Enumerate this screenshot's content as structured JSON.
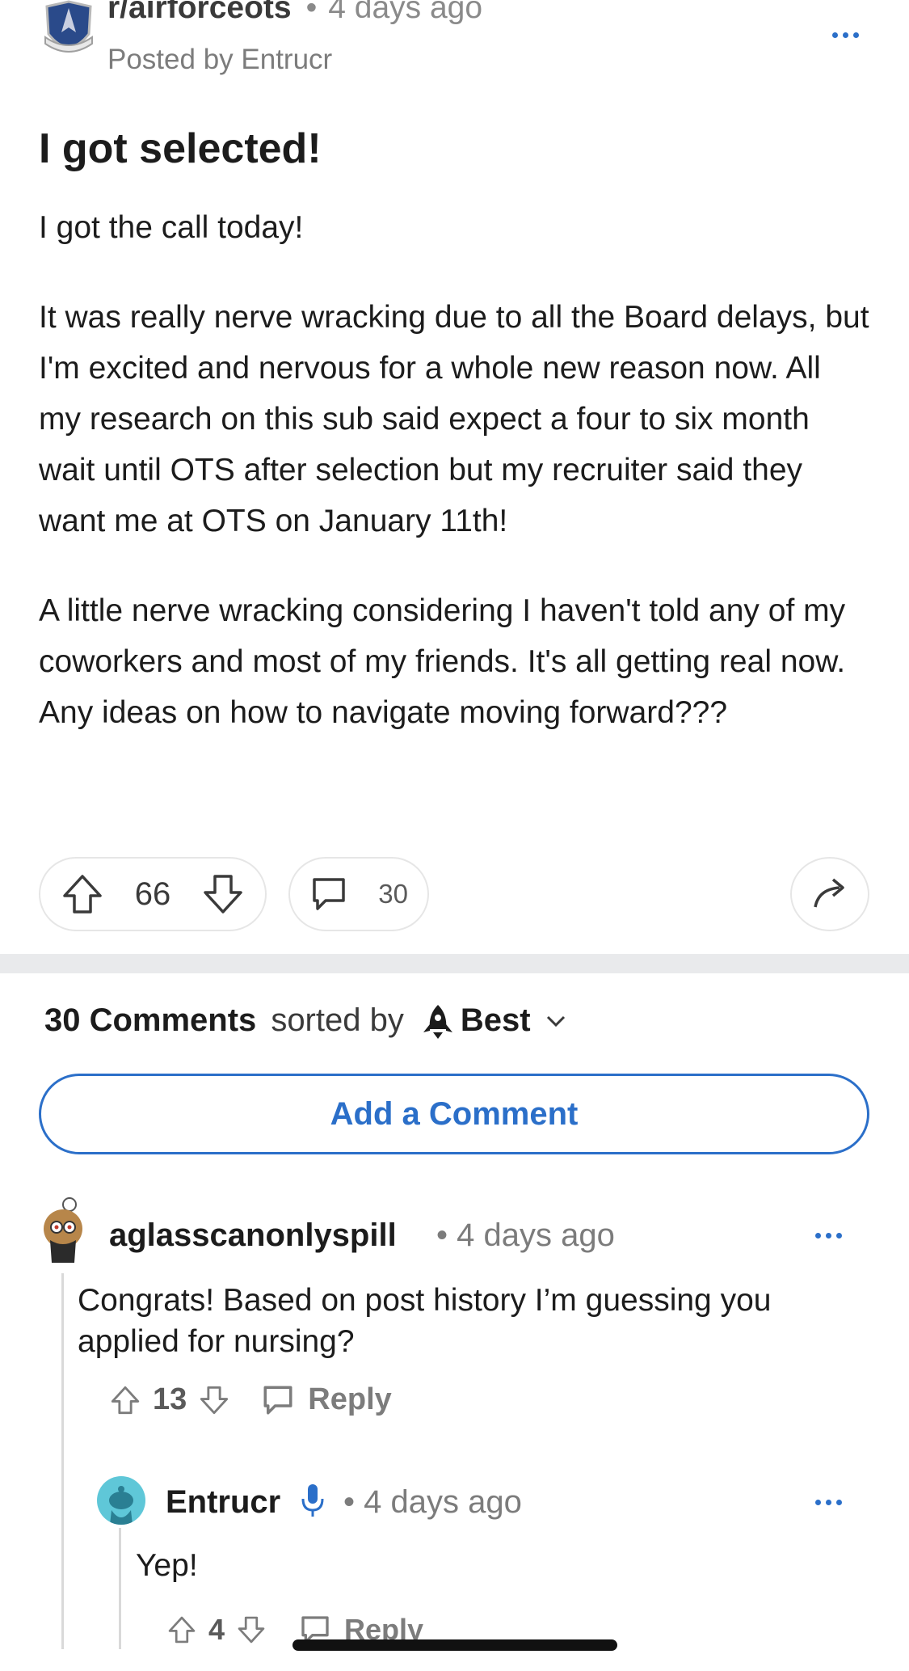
{
  "post": {
    "subreddit": "r/airforceots",
    "separator": "•",
    "age": "4 days ago",
    "posted_by": "Posted by Entrucr",
    "title": "I got selected!",
    "body": [
      "I got the call today!",
      "It was really nerve wracking due to all the Board delays, but I'm excited and nervous for a whole new reason now. All my research on this sub said expect a four to six month wait until OTS after selection but my recruiter said they want me at OTS on January 11th!",
      "A little nerve wracking considering I haven't told any of my coworkers and most of my friends. It's all getting real now. Any ideas on how to navigate moving forward???"
    ],
    "votes": "66",
    "comment_count": "30"
  },
  "comments_header": {
    "count_label": "30 Comments",
    "sorted_by": "sorted by",
    "sort_value": "Best"
  },
  "add_comment_label": "Add a Comment",
  "comments": [
    {
      "user": "aglasscanonlyspill",
      "meta": "• 4 days ago",
      "body": "Congrats! Based on post history I’m guessing you applied for nursing?",
      "votes": "13",
      "reply_label": "Reply"
    },
    {
      "user": "Entrucr",
      "meta": "• 4 days ago",
      "body": "Yep!",
      "votes": "4",
      "reply_label": "Reply"
    }
  ],
  "colors": {
    "accent": "#2b6fc9",
    "divider": "#e9eaec",
    "meta_text": "#7c7c7c",
    "reply_avatar": "#5fc7d8"
  },
  "icons": [
    "subreddit-logo-icon",
    "more-options-icon",
    "upvote-icon",
    "downvote-icon",
    "comment-icon",
    "share-icon",
    "sort-rocket-icon",
    "chevron-down-icon",
    "mic-icon",
    "user-avatar-icon"
  ]
}
